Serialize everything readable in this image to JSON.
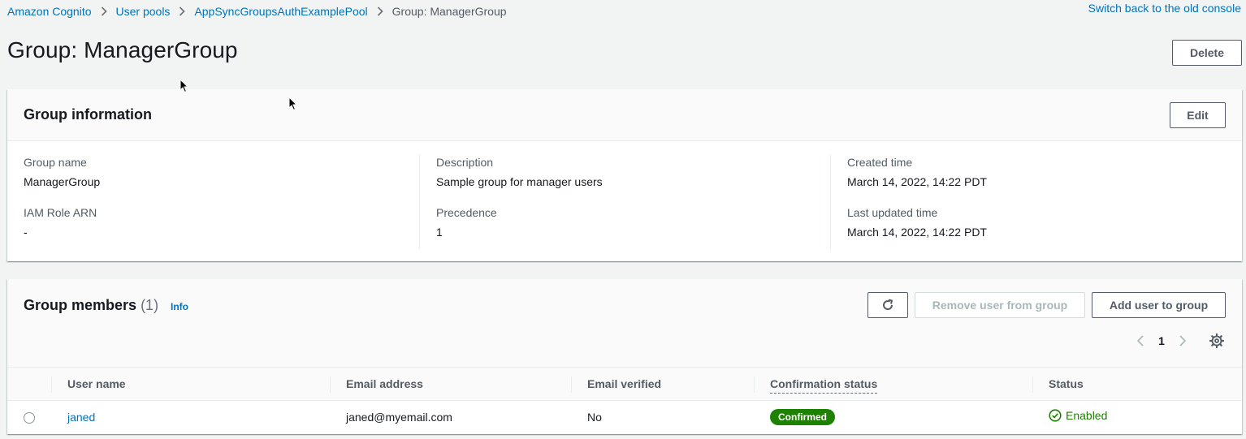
{
  "breadcrumb": {
    "items": [
      "Amazon Cognito",
      "User pools",
      "AppSyncGroupsAuthExamplePool"
    ],
    "current": "Group: ManagerGroup"
  },
  "old_console_link": "Switch back to the old console",
  "page_title": "Group: ManagerGroup",
  "delete_label": "Delete",
  "group_info": {
    "title": "Group information",
    "edit_label": "Edit",
    "fields": {
      "group_name": {
        "label": "Group name",
        "value": "ManagerGroup"
      },
      "iam_role_arn": {
        "label": "IAM Role ARN",
        "value": "-"
      },
      "description": {
        "label": "Description",
        "value": "Sample group for manager users"
      },
      "precedence": {
        "label": "Precedence",
        "value": "1"
      },
      "created_time": {
        "label": "Created time",
        "value": "March 14, 2022, 14:22 PDT"
      },
      "last_updated_time": {
        "label": "Last updated time",
        "value": "March 14, 2022, 14:22 PDT"
      }
    }
  },
  "group_members": {
    "title": "Group members",
    "count": "(1)",
    "info_label": "Info",
    "remove_label": "Remove user from group",
    "add_label": "Add user to group",
    "page_number": "1",
    "columns": [
      "User name",
      "Email address",
      "Email verified",
      "Confirmation status",
      "Status"
    ],
    "rows": [
      {
        "user_name": "janed",
        "email": "janed@myemail.com",
        "email_verified": "No",
        "confirmation_status": "Confirmed",
        "status": "Enabled"
      }
    ]
  },
  "colors": {
    "link": "#0073bb",
    "success": "#1d8102",
    "background": "#f2f3f3"
  }
}
